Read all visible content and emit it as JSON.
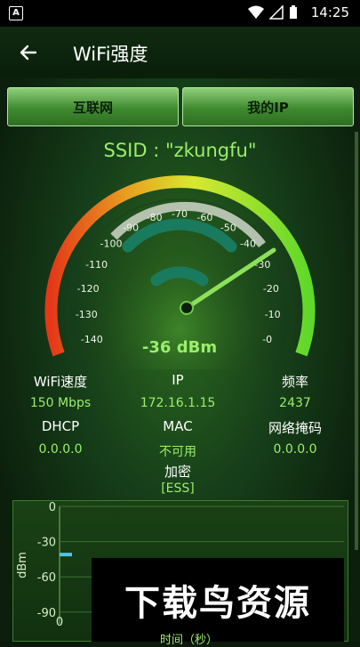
{
  "status_bar": {
    "time": "14:25",
    "app_badge": "A"
  },
  "app_bar": {
    "title": "WiFi强度"
  },
  "tabs": [
    {
      "label": "互联网"
    },
    {
      "label": "我的IP"
    }
  ],
  "ssid": "SSID : \"zkungfu\"",
  "gauge": {
    "reading": "-36 dBm",
    "value": -36,
    "min": -140,
    "max": 0,
    "ticks": [
      "-140",
      "-130",
      "-120",
      "-110",
      "-100",
      "-90",
      "-80",
      "-70",
      "-60",
      "-50",
      "-40",
      "-30",
      "-20",
      "-10",
      "-0"
    ]
  },
  "info": [
    {
      "label": "WiFi速度",
      "value": "150 Mbps"
    },
    {
      "label": "IP",
      "value": "172.16.1.15"
    },
    {
      "label": "频率",
      "value": "2437"
    },
    {
      "label": "DHCP",
      "value": "0.0.0.0"
    },
    {
      "label": "MAC",
      "value": "不可用"
    },
    {
      "label": "网络掩码",
      "value": "0.0.0.0"
    },
    {
      "label": "加密",
      "value": "[ESS]"
    }
  ],
  "chart_data": {
    "type": "line",
    "ylabel": "dBm",
    "xlabel": "时间（秒）",
    "ylim": [
      -100,
      0
    ],
    "yticks": [
      "0",
      "-30",
      "-60",
      "-90"
    ],
    "xticks": [
      "0"
    ],
    "series": [
      {
        "values": [
          -41
        ]
      }
    ]
  },
  "watermark": "下载鸟资源",
  "colors": {
    "accent": "#9cee6a",
    "background": "#0c1a0c"
  }
}
